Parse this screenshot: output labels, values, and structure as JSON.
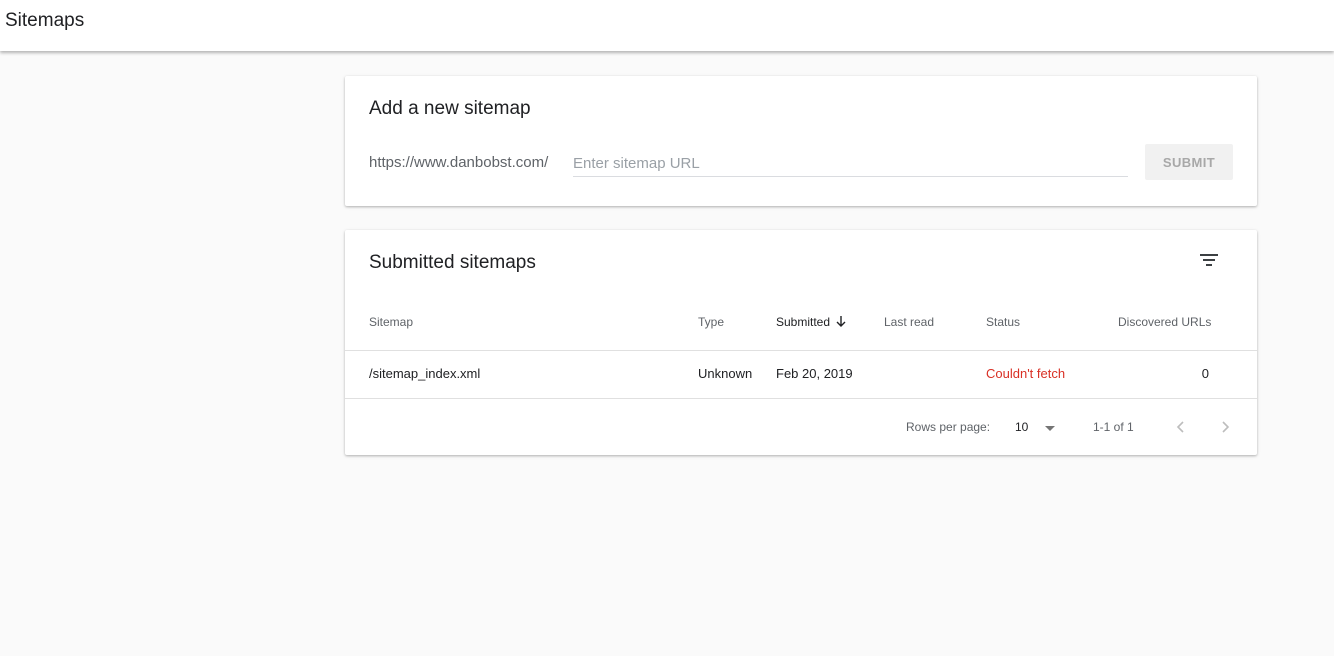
{
  "header": {
    "title": "Sitemaps"
  },
  "add_sitemap": {
    "title": "Add a new sitemap",
    "url_prefix": "https://www.danbobst.com/",
    "input_value": "",
    "input_placeholder": "Enter sitemap URL",
    "submit_label": "SUBMIT"
  },
  "submitted_sitemaps": {
    "title": "Submitted sitemaps",
    "filter_icon": "filter-list-icon",
    "columns": {
      "sitemap": "Sitemap",
      "type": "Type",
      "submitted": "Submitted",
      "last_read": "Last read",
      "status": "Status",
      "discovered_urls": "Discovered URLs"
    },
    "sort": {
      "column": "submitted",
      "direction": "descending",
      "icon": "arrow-down-icon"
    },
    "rows": [
      {
        "sitemap": "/sitemap_index.xml",
        "type": "Unknown",
        "submitted": "Feb 20, 2019",
        "last_read": "",
        "status": "Couldn't fetch",
        "discovered_urls": "0"
      }
    ],
    "pagination": {
      "rows_per_page_label": "Rows per page:",
      "rows_per_page_value": "10",
      "range_label": "1-1 of 1",
      "prev_icon": "chevron-left-icon",
      "next_icon": "chevron-right-icon"
    }
  },
  "colors": {
    "background": "#fafafa",
    "card": "#ffffff",
    "error_status": "#d93025",
    "muted_text": "#5f6368"
  }
}
